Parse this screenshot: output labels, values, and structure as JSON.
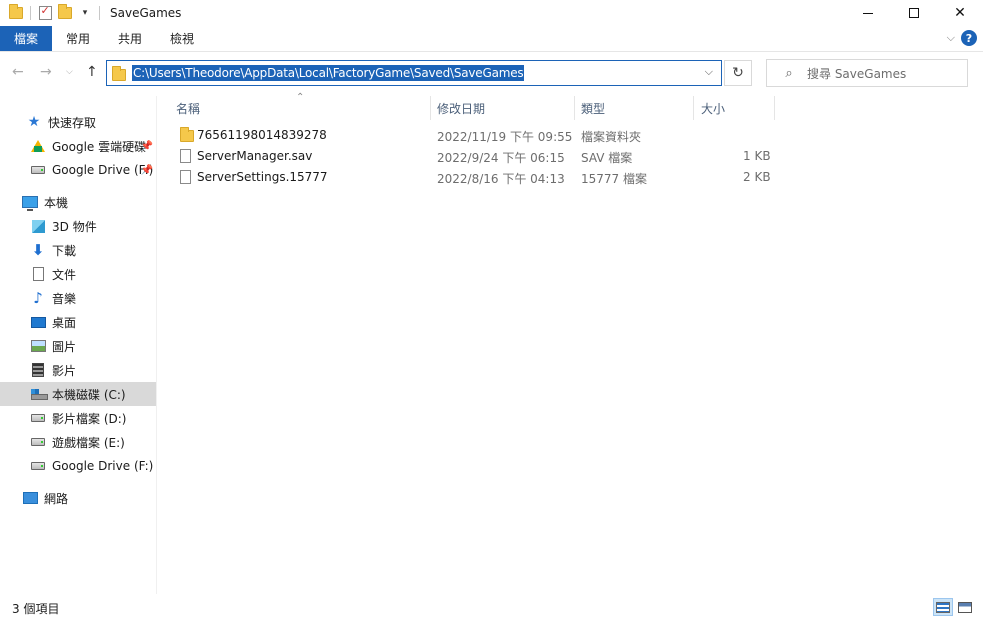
{
  "window": {
    "title": "SaveGames"
  },
  "ribbon": {
    "tabs": [
      "檔案",
      "常用",
      "共用",
      "檢視"
    ],
    "help": "?"
  },
  "address": {
    "path": "C:\\Users\\Theodore\\AppData\\Local\\FactoryGame\\Saved\\SaveGames"
  },
  "search": {
    "placeholder": "搜尋 SaveGames"
  },
  "sidebar": {
    "quick_access": "快速存取",
    "items": [
      {
        "label": "Google 雲端硬碟",
        "icon": "google-drive-icon",
        "pinned": true
      },
      {
        "label": "Google Drive (F:)",
        "icon": "drive-icon",
        "pinned": true
      }
    ],
    "this_pc": "本機",
    "pc_items": [
      {
        "label": "3D 物件",
        "icon": "cube-icon"
      },
      {
        "label": "下載",
        "icon": "download-icon"
      },
      {
        "label": "文件",
        "icon": "document-icon"
      },
      {
        "label": "音樂",
        "icon": "music-icon"
      },
      {
        "label": "桌面",
        "icon": "desktop-icon"
      },
      {
        "label": "圖片",
        "icon": "pictures-icon"
      },
      {
        "label": "影片",
        "icon": "videos-icon"
      },
      {
        "label": "本機磁碟 (C:)",
        "icon": "system-drive-icon",
        "selected": true
      },
      {
        "label": "影片檔案 (D:)",
        "icon": "drive-icon"
      },
      {
        "label": "遊戲檔案 (E:)",
        "icon": "drive-icon"
      },
      {
        "label": "Google Drive (F:)",
        "icon": "drive-icon"
      }
    ],
    "network": "網路"
  },
  "columns": {
    "name": "名稱",
    "date": "修改日期",
    "type": "類型",
    "size": "大小"
  },
  "files": [
    {
      "name": "76561198014839278",
      "date": "2022/11/19 下午 09:55",
      "type": "檔案資料夾",
      "size": "",
      "icon": "folder-icon"
    },
    {
      "name": "ServerManager.sav",
      "date": "2022/9/24 下午 06:15",
      "type": "SAV 檔案",
      "size": "1 KB",
      "icon": "file-icon"
    },
    {
      "name": "ServerSettings.15777",
      "date": "2022/8/16 下午 04:13",
      "type": "15777 檔案",
      "size": "2 KB",
      "icon": "file-icon"
    }
  ],
  "status": {
    "item_count": "3 個項目"
  },
  "colors": {
    "accent": "#1c63b7",
    "selection": "#d9d9d9"
  }
}
